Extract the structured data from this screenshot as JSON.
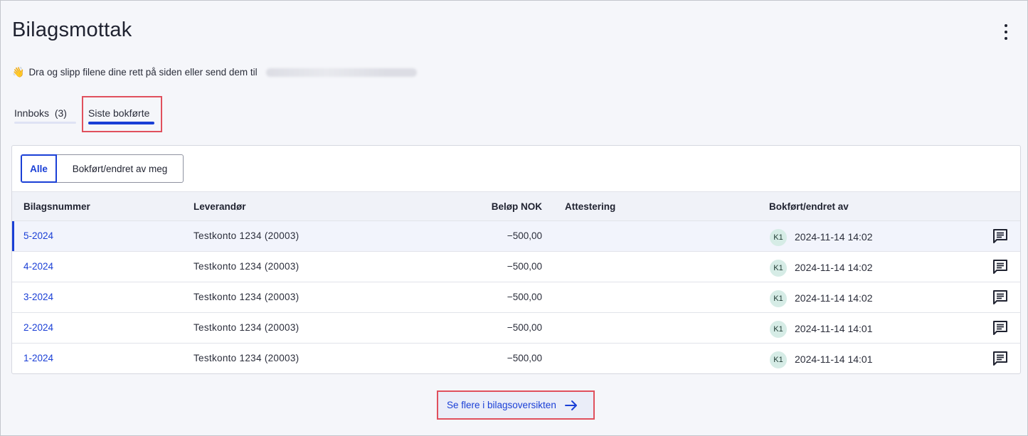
{
  "page": {
    "title": "Bilagsmottak",
    "menu_icon": "kebab-menu-icon"
  },
  "hint": {
    "emoji": "👋",
    "text": "Dra og slipp filene dine rett på siden eller send dem til"
  },
  "tabs": [
    {
      "label": "Innboks  (3)"
    },
    {
      "label": "Siste bokførte"
    }
  ],
  "filter": {
    "all_label": "Alle",
    "mine_label": "Bokført/endret av meg"
  },
  "table": {
    "columns": [
      "Bilagsnummer",
      "Leverandør",
      "Beløp NOK",
      "Attestering",
      "Bokført/endret av"
    ],
    "rows": [
      {
        "number": "5-2024",
        "supplier": "Testkonto 1234 (20003)",
        "amount": "−500,00",
        "attest": "",
        "initials": "K1",
        "date": "2024-11-14 14:02"
      },
      {
        "number": "4-2024",
        "supplier": "Testkonto 1234 (20003)",
        "amount": "−500,00",
        "attest": "",
        "initials": "K1",
        "date": "2024-11-14 14:02"
      },
      {
        "number": "3-2024",
        "supplier": "Testkonto 1234 (20003)",
        "amount": "−500,00",
        "attest": "",
        "initials": "K1",
        "date": "2024-11-14 14:02"
      },
      {
        "number": "2-2024",
        "supplier": "Testkonto 1234 (20003)",
        "amount": "−500,00",
        "attest": "",
        "initials": "K1",
        "date": "2024-11-14 14:01"
      },
      {
        "number": "1-2024",
        "supplier": "Testkonto 1234 (20003)",
        "amount": "−500,00",
        "attest": "",
        "initials": "K1",
        "date": "2024-11-14 14:01"
      }
    ]
  },
  "footer": {
    "more_label": "Se flere i bilagsoversikten"
  },
  "colors": {
    "accent": "#1a3fd6",
    "highlight_border": "#e0505d",
    "avatar_bg": "#d6ece6"
  }
}
